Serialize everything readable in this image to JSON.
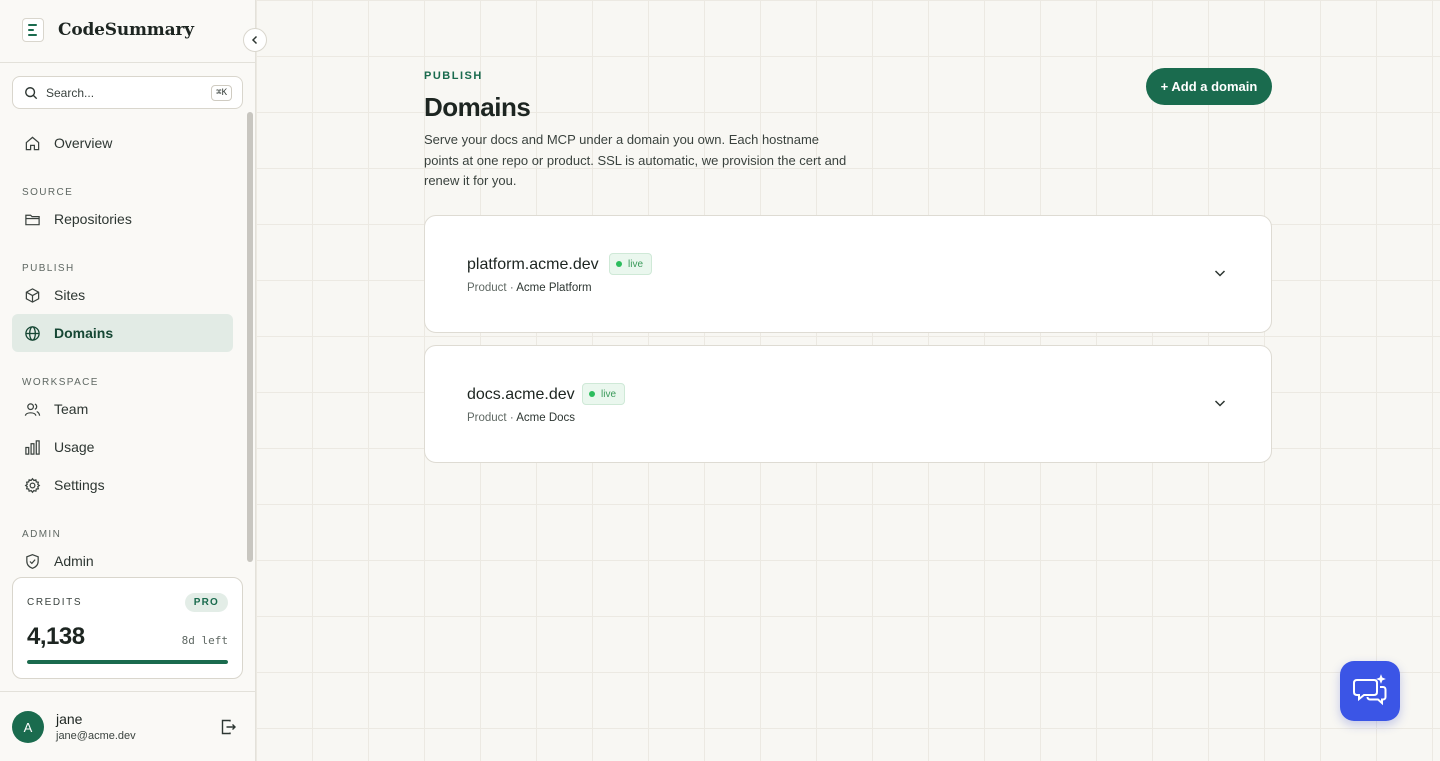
{
  "brand": {
    "name": "CodeSummary"
  },
  "search": {
    "placeholder": "Search...",
    "shortcut": "⌘K"
  },
  "nav": {
    "overview": "Overview",
    "sections": {
      "source": "SOURCE",
      "publish": "PUBLISH",
      "workspace": "WORKSPACE",
      "admin": "ADMIN"
    },
    "repositories": "Repositories",
    "sites": "Sites",
    "domains": "Domains",
    "team": "Team",
    "usage": "Usage",
    "settings": "Settings",
    "admin": "Admin",
    "active": "Domains"
  },
  "credits": {
    "label": "CREDITS",
    "plan": "PRO",
    "value": "4,138",
    "remaining": "8d left",
    "progress_fraction": 1.0
  },
  "user": {
    "initial": "A",
    "name": "jane",
    "email": "jane@acme.dev"
  },
  "page": {
    "eyebrow": "PUBLISH",
    "title": "Domains",
    "description": "Serve your docs and MCP under a domain you own. Each hostname points at one repo or product. SSL is automatic, we provision the cert and renew it for you.",
    "add_button": "+ Add a domain"
  },
  "domains": [
    {
      "host": "platform.acme.dev",
      "status": "live",
      "type": "Product",
      "target": "Acme Platform"
    },
    {
      "host": "docs.acme.dev",
      "status": "live",
      "type": "Product",
      "target": "Acme Docs"
    }
  ],
  "colors": {
    "accent": "#1a6b4e",
    "live": "#2dbd5e",
    "chat": "#3b55e6"
  }
}
